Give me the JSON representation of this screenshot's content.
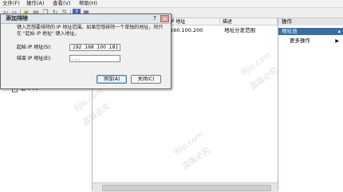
{
  "menu": {
    "file": "文件(F)",
    "action": "操作(A)",
    "view": "查看(V)",
    "help": "帮助(H)"
  },
  "toolbar": {
    "back_icon": "back-arrow-icon",
    "forward_icon": "forward-arrow-icon",
    "help_icon": "help-icon"
  },
  "list": {
    "columns": [
      "IP 地址",
      "描述"
    ],
    "rows": [
      {
        "ip": "160.100.200",
        "desc": "地址分发范围"
      }
    ]
  },
  "actions": {
    "header": "操作",
    "selected": "地址池",
    "more": "更多操作"
  },
  "tree": {
    "ipv6_label": "IPv6"
  },
  "dialog": {
    "title": "添加排除",
    "help": "?",
    "close": "×",
    "description": "键入您想要排除的 IP 地址范围。如果您想排除一个单独的地址，则只在 \"起始 IP 地址\" 键入地址。",
    "start_label": "起始 IP 地址(S):",
    "start_value": "192 .168 .100 .181",
    "end_label": "结束 IP 地址(E):",
    "end_value": " .    .    .",
    "add_button": "添加(A)",
    "close_button": "关闭(C)"
  },
  "watermark": [
    "9jiu.com",
    "盗版必究"
  ]
}
